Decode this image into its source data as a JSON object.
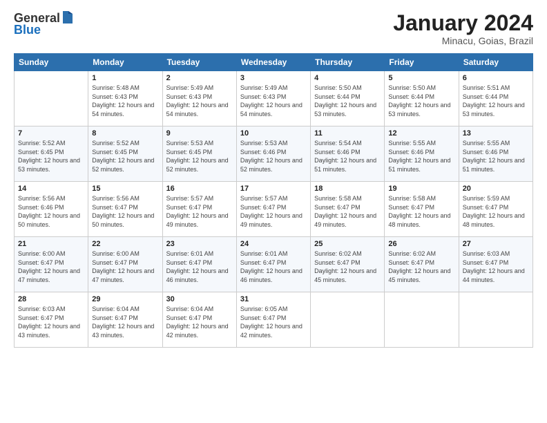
{
  "header": {
    "logo_general": "General",
    "logo_blue": "Blue",
    "month_year": "January 2024",
    "location": "Minacu, Goias, Brazil"
  },
  "days_of_week": [
    "Sunday",
    "Monday",
    "Tuesday",
    "Wednesday",
    "Thursday",
    "Friday",
    "Saturday"
  ],
  "weeks": [
    [
      {
        "day": "",
        "sunrise": "",
        "sunset": "",
        "daylight": ""
      },
      {
        "day": "1",
        "sunrise": "Sunrise: 5:48 AM",
        "sunset": "Sunset: 6:43 PM",
        "daylight": "Daylight: 12 hours and 54 minutes."
      },
      {
        "day": "2",
        "sunrise": "Sunrise: 5:49 AM",
        "sunset": "Sunset: 6:43 PM",
        "daylight": "Daylight: 12 hours and 54 minutes."
      },
      {
        "day": "3",
        "sunrise": "Sunrise: 5:49 AM",
        "sunset": "Sunset: 6:43 PM",
        "daylight": "Daylight: 12 hours and 54 minutes."
      },
      {
        "day": "4",
        "sunrise": "Sunrise: 5:50 AM",
        "sunset": "Sunset: 6:44 PM",
        "daylight": "Daylight: 12 hours and 53 minutes."
      },
      {
        "day": "5",
        "sunrise": "Sunrise: 5:50 AM",
        "sunset": "Sunset: 6:44 PM",
        "daylight": "Daylight: 12 hours and 53 minutes."
      },
      {
        "day": "6",
        "sunrise": "Sunrise: 5:51 AM",
        "sunset": "Sunset: 6:44 PM",
        "daylight": "Daylight: 12 hours and 53 minutes."
      }
    ],
    [
      {
        "day": "7",
        "sunrise": "Sunrise: 5:52 AM",
        "sunset": "Sunset: 6:45 PM",
        "daylight": "Daylight: 12 hours and 53 minutes."
      },
      {
        "day": "8",
        "sunrise": "Sunrise: 5:52 AM",
        "sunset": "Sunset: 6:45 PM",
        "daylight": "Daylight: 12 hours and 52 minutes."
      },
      {
        "day": "9",
        "sunrise": "Sunrise: 5:53 AM",
        "sunset": "Sunset: 6:45 PM",
        "daylight": "Daylight: 12 hours and 52 minutes."
      },
      {
        "day": "10",
        "sunrise": "Sunrise: 5:53 AM",
        "sunset": "Sunset: 6:46 PM",
        "daylight": "Daylight: 12 hours and 52 minutes."
      },
      {
        "day": "11",
        "sunrise": "Sunrise: 5:54 AM",
        "sunset": "Sunset: 6:46 PM",
        "daylight": "Daylight: 12 hours and 51 minutes."
      },
      {
        "day": "12",
        "sunrise": "Sunrise: 5:55 AM",
        "sunset": "Sunset: 6:46 PM",
        "daylight": "Daylight: 12 hours and 51 minutes."
      },
      {
        "day": "13",
        "sunrise": "Sunrise: 5:55 AM",
        "sunset": "Sunset: 6:46 PM",
        "daylight": "Daylight: 12 hours and 51 minutes."
      }
    ],
    [
      {
        "day": "14",
        "sunrise": "Sunrise: 5:56 AM",
        "sunset": "Sunset: 6:46 PM",
        "daylight": "Daylight: 12 hours and 50 minutes."
      },
      {
        "day": "15",
        "sunrise": "Sunrise: 5:56 AM",
        "sunset": "Sunset: 6:47 PM",
        "daylight": "Daylight: 12 hours and 50 minutes."
      },
      {
        "day": "16",
        "sunrise": "Sunrise: 5:57 AM",
        "sunset": "Sunset: 6:47 PM",
        "daylight": "Daylight: 12 hours and 49 minutes."
      },
      {
        "day": "17",
        "sunrise": "Sunrise: 5:57 AM",
        "sunset": "Sunset: 6:47 PM",
        "daylight": "Daylight: 12 hours and 49 minutes."
      },
      {
        "day": "18",
        "sunrise": "Sunrise: 5:58 AM",
        "sunset": "Sunset: 6:47 PM",
        "daylight": "Daylight: 12 hours and 49 minutes."
      },
      {
        "day": "19",
        "sunrise": "Sunrise: 5:58 AM",
        "sunset": "Sunset: 6:47 PM",
        "daylight": "Daylight: 12 hours and 48 minutes."
      },
      {
        "day": "20",
        "sunrise": "Sunrise: 5:59 AM",
        "sunset": "Sunset: 6:47 PM",
        "daylight": "Daylight: 12 hours and 48 minutes."
      }
    ],
    [
      {
        "day": "21",
        "sunrise": "Sunrise: 6:00 AM",
        "sunset": "Sunset: 6:47 PM",
        "daylight": "Daylight: 12 hours and 47 minutes."
      },
      {
        "day": "22",
        "sunrise": "Sunrise: 6:00 AM",
        "sunset": "Sunset: 6:47 PM",
        "daylight": "Daylight: 12 hours and 47 minutes."
      },
      {
        "day": "23",
        "sunrise": "Sunrise: 6:01 AM",
        "sunset": "Sunset: 6:47 PM",
        "daylight": "Daylight: 12 hours and 46 minutes."
      },
      {
        "day": "24",
        "sunrise": "Sunrise: 6:01 AM",
        "sunset": "Sunset: 6:47 PM",
        "daylight": "Daylight: 12 hours and 46 minutes."
      },
      {
        "day": "25",
        "sunrise": "Sunrise: 6:02 AM",
        "sunset": "Sunset: 6:47 PM",
        "daylight": "Daylight: 12 hours and 45 minutes."
      },
      {
        "day": "26",
        "sunrise": "Sunrise: 6:02 AM",
        "sunset": "Sunset: 6:47 PM",
        "daylight": "Daylight: 12 hours and 45 minutes."
      },
      {
        "day": "27",
        "sunrise": "Sunrise: 6:03 AM",
        "sunset": "Sunset: 6:47 PM",
        "daylight": "Daylight: 12 hours and 44 minutes."
      }
    ],
    [
      {
        "day": "28",
        "sunrise": "Sunrise: 6:03 AM",
        "sunset": "Sunset: 6:47 PM",
        "daylight": "Daylight: 12 hours and 43 minutes."
      },
      {
        "day": "29",
        "sunrise": "Sunrise: 6:04 AM",
        "sunset": "Sunset: 6:47 PM",
        "daylight": "Daylight: 12 hours and 43 minutes."
      },
      {
        "day": "30",
        "sunrise": "Sunrise: 6:04 AM",
        "sunset": "Sunset: 6:47 PM",
        "daylight": "Daylight: 12 hours and 42 minutes."
      },
      {
        "day": "31",
        "sunrise": "Sunrise: 6:05 AM",
        "sunset": "Sunset: 6:47 PM",
        "daylight": "Daylight: 12 hours and 42 minutes."
      },
      {
        "day": "",
        "sunrise": "",
        "sunset": "",
        "daylight": ""
      },
      {
        "day": "",
        "sunrise": "",
        "sunset": "",
        "daylight": ""
      },
      {
        "day": "",
        "sunrise": "",
        "sunset": "",
        "daylight": ""
      }
    ]
  ]
}
